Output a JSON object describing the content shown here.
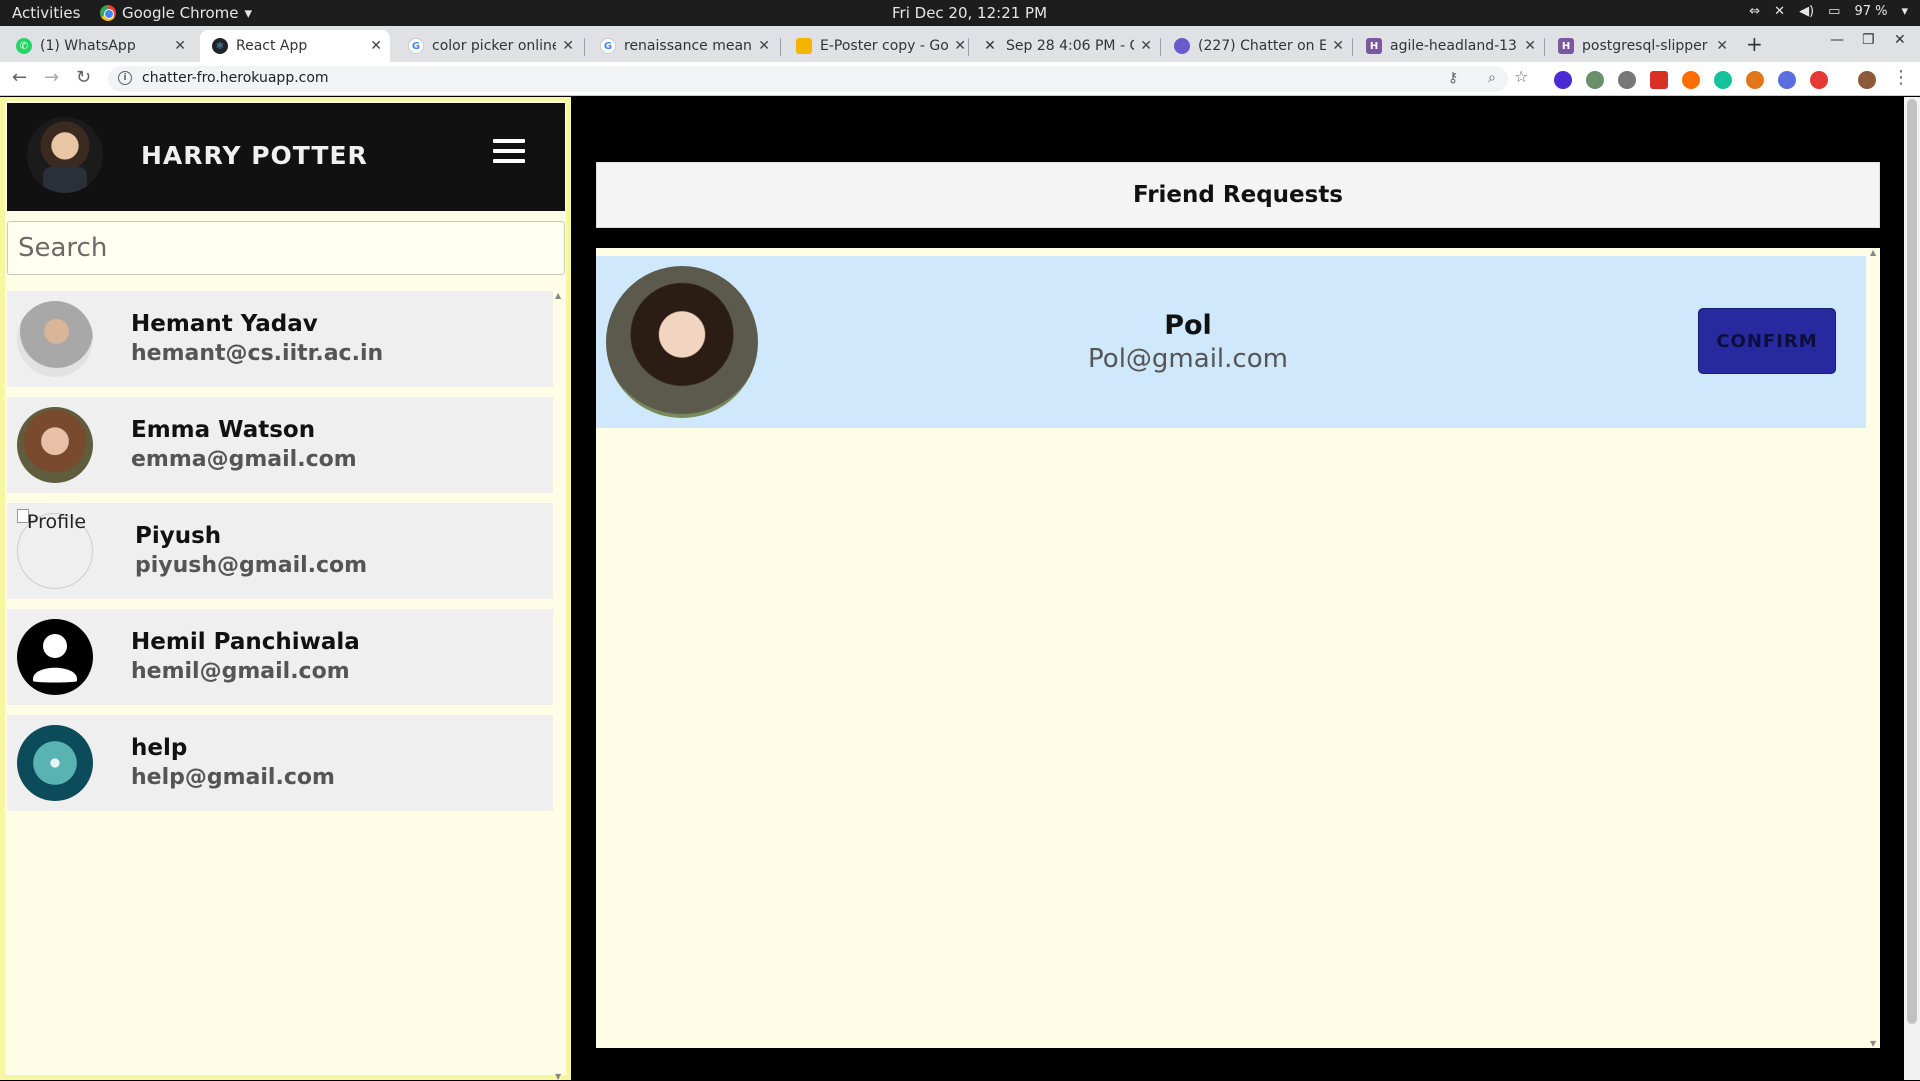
{
  "os": {
    "activities": "Activities",
    "app_name": "Google Chrome",
    "clock": "Fri Dec 20, 12:21 PM",
    "battery": "97 %"
  },
  "tabs": [
    {
      "label": "(1) WhatsApp",
      "favicon_color": "#25d366"
    },
    {
      "label": "React App",
      "favicon_color": "#61dafb"
    },
    {
      "label": "color picker online",
      "favicon_color": "#4285f4"
    },
    {
      "label": "renaissance meani",
      "favicon_color": "#4285f4"
    },
    {
      "label": "E-Poster copy - Go",
      "favicon_color": "#f4b400"
    },
    {
      "label": "Sep 28 4:06 PM - C",
      "favicon_color": "#333333"
    },
    {
      "label": "(227) Chatter on E",
      "favicon_color": "#6a5acd"
    },
    {
      "label": "agile-headland-13",
      "favicon_color": "#79589f"
    },
    {
      "label": "postgresql-slipper",
      "favicon_color": "#79589f"
    }
  ],
  "browser": {
    "url": "chatter-fro.herokuapp.com"
  },
  "sidebar": {
    "user_name": "HARRY POTTER",
    "search_placeholder": "Search",
    "profile_alt": "Profile",
    "friends": [
      {
        "name": "Hemant Yadav",
        "email": "hemant@cs.iitr.ac.in",
        "avatar": "photo"
      },
      {
        "name": "Emma Watson",
        "email": "emma@gmail.com",
        "avatar": "photo"
      },
      {
        "name": "Piyush",
        "email": "piyush@gmail.com",
        "avatar": "broken"
      },
      {
        "name": "Hemil Panchiwala",
        "email": "hemil@gmail.com",
        "avatar": "person-icon"
      },
      {
        "name": "help",
        "email": "help@gmail.com",
        "avatar": "photo"
      }
    ]
  },
  "main": {
    "title": "Friend Requests",
    "requests": [
      {
        "name": "Pol",
        "email": "Pol@gmail.com",
        "button": "CONFIRM"
      }
    ]
  },
  "colors": {
    "sidebar_bg": "#fffde6",
    "request_bg": "#cfe8fb",
    "confirm_bg": "#262a9e",
    "header_bg": "#111111"
  }
}
